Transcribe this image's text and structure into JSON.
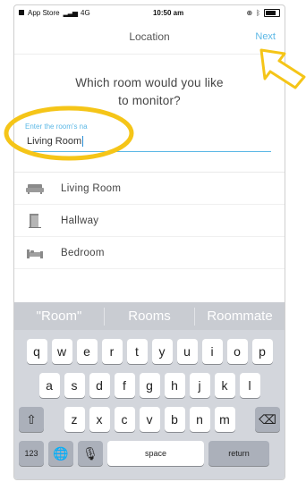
{
  "status_bar": {
    "carrier": "App Store",
    "network": "4G",
    "time": "10:50 am"
  },
  "nav": {
    "title": "Location",
    "next_label": "Next"
  },
  "main": {
    "question_line1": "Which room would you like",
    "question_line2": "to monitor?",
    "input": {
      "label": "Enter the room's na",
      "value": "Living Room"
    },
    "suggestions": [
      {
        "label": "Living Room",
        "icon": "sofa-icon"
      },
      {
        "label": "Hallway",
        "icon": "door-icon"
      },
      {
        "label": "Bedroom",
        "icon": "bed-icon"
      }
    ]
  },
  "keyboard": {
    "predictions": [
      "\"Room\"",
      "Rooms",
      "Roommate"
    ],
    "row1": [
      "q",
      "w",
      "e",
      "r",
      "t",
      "y",
      "u",
      "i",
      "o",
      "p"
    ],
    "row2": [
      "a",
      "s",
      "d",
      "f",
      "g",
      "h",
      "j",
      "k",
      "l"
    ],
    "row3": [
      "z",
      "x",
      "c",
      "v",
      "b",
      "n",
      "m"
    ],
    "numbers_label": "123",
    "space_label": "space",
    "return_label": "return"
  },
  "colors": {
    "accent": "#5cb8e6",
    "annotation": "#f5c518"
  }
}
